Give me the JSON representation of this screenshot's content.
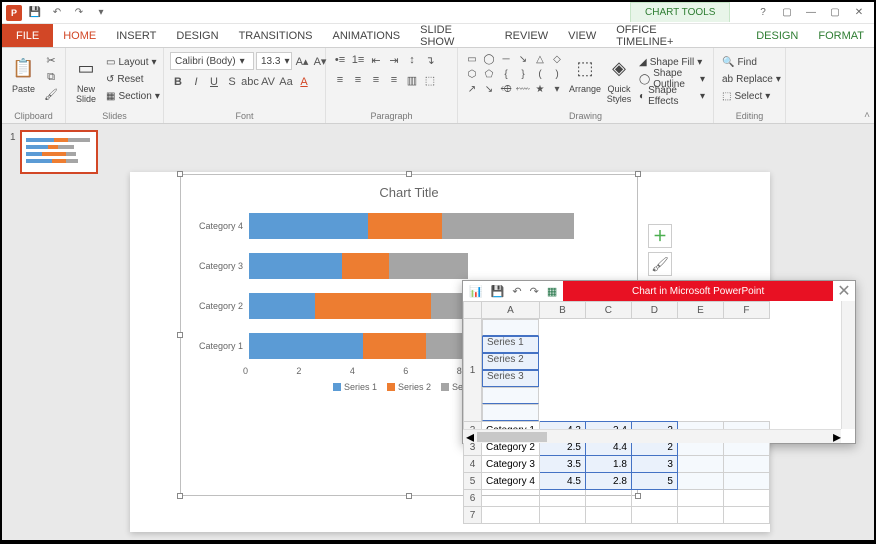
{
  "titlebar": {
    "context_tab": "CHART TOOLS"
  },
  "tabs": {
    "file": "FILE",
    "items": [
      "HOME",
      "INSERT",
      "DESIGN",
      "TRANSITIONS",
      "ANIMATIONS",
      "SLIDE SHOW",
      "REVIEW",
      "VIEW",
      "OFFICE TIMELINE+"
    ],
    "context": [
      "DESIGN",
      "FORMAT"
    ]
  },
  "ribbon": {
    "clipboard": {
      "label": "Clipboard",
      "paste": "Paste"
    },
    "slides": {
      "label": "Slides",
      "new_slide": "New\nSlide",
      "layout": "Layout",
      "reset": "Reset",
      "section": "Section"
    },
    "font": {
      "label": "Font",
      "name": "Calibri (Body)",
      "size": "13.3"
    },
    "paragraph": {
      "label": "Paragraph"
    },
    "drawing": {
      "label": "Drawing",
      "arrange": "Arrange",
      "quick": "Quick\nStyles",
      "fill": "Shape Fill",
      "outline": "Shape Outline",
      "effects": "Shape Effects"
    },
    "editing": {
      "label": "Editing",
      "find": "Find",
      "replace": "Replace",
      "select": "Select"
    }
  },
  "thumb": {
    "num": "1"
  },
  "chart_data": {
    "type": "bar",
    "title": "Chart Title",
    "orientation": "horizontal-stacked",
    "categories": [
      "Category 1",
      "Category 2",
      "Category 3",
      "Category 4"
    ],
    "series": [
      {
        "name": "Series 1",
        "values": [
          4.3,
          2.5,
          3.5,
          4.5
        ]
      },
      {
        "name": "Series 2",
        "values": [
          2.4,
          4.4,
          1.8,
          2.8
        ]
      },
      {
        "name": "Series 3",
        "values": [
          2,
          2,
          3,
          5
        ]
      }
    ],
    "xlabel": "",
    "ylabel": "",
    "xlim": [
      0,
      14
    ],
    "xticks": [
      0,
      2,
      4,
      6,
      8,
      10,
      12,
      14
    ],
    "legend_position": "bottom",
    "display_order": [
      "Category 4",
      "Category 3",
      "Category 2",
      "Category 1"
    ]
  },
  "side_tools": {
    "add": "+",
    "brush": "🖌",
    "filter": "▼"
  },
  "sheet": {
    "title": "Chart in Microsoft PowerPoint",
    "cols": [
      "A",
      "B",
      "C",
      "D",
      "E",
      "F"
    ],
    "header_row": [
      "",
      "Series 1",
      "Series 2",
      "Series 3",
      "",
      ""
    ],
    "rows": [
      {
        "n": "2",
        "cat": "Category 1",
        "v": [
          "4.3",
          "2.4",
          "2"
        ]
      },
      {
        "n": "3",
        "cat": "Category 2",
        "v": [
          "2.5",
          "4.4",
          "2"
        ]
      },
      {
        "n": "4",
        "cat": "Category 3",
        "v": [
          "3.5",
          "1.8",
          "3"
        ]
      },
      {
        "n": "5",
        "cat": "Category 4",
        "v": [
          "4.5",
          "2.8",
          "5"
        ]
      }
    ]
  }
}
